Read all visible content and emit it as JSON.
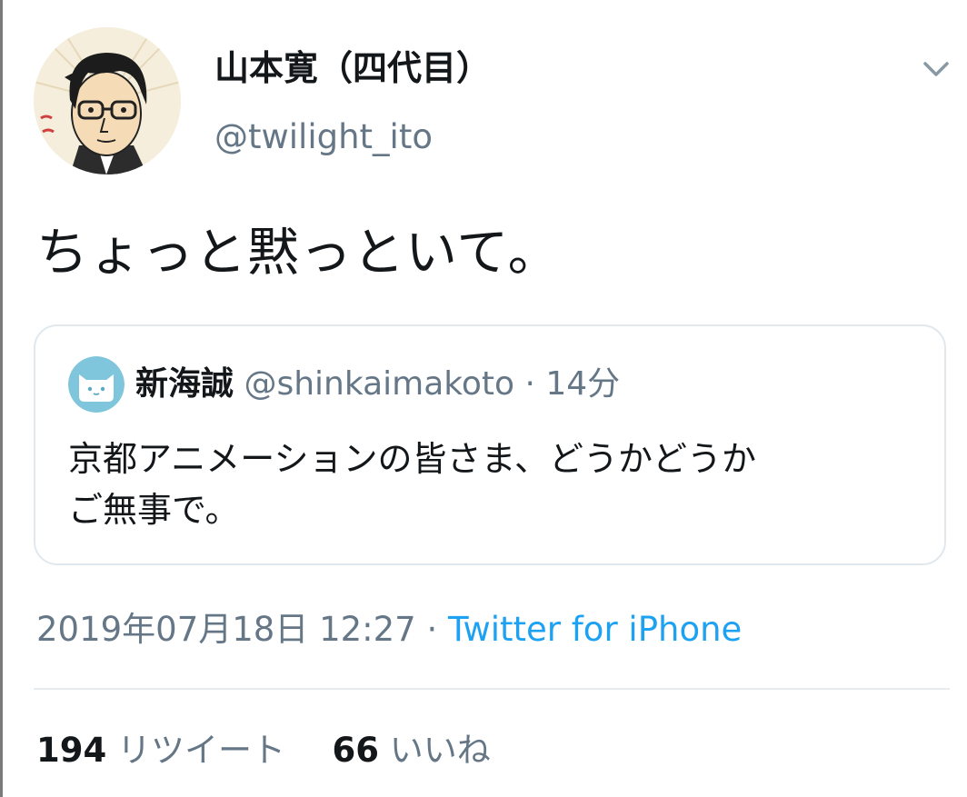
{
  "tweet": {
    "author": {
      "display_name": "山本寛（四代目）",
      "handle": "@twilight_ito"
    },
    "text": "ちょっと黙っといて。",
    "quoted": {
      "display_name": "新海誠",
      "handle": "@shinkaimakoto",
      "separator": "·",
      "time": "14分",
      "text_lines": [
        "京都アニメーションの皆さま、どうかどうか",
        "ご無事で。"
      ]
    },
    "timestamp": "2019年07月18日 12:27",
    "separator": "·",
    "source": "Twitter for iPhone",
    "stats": {
      "retweets_count": "194",
      "retweets_label": "リツイート",
      "likes_count": "66",
      "likes_label": "いいね"
    }
  },
  "icons": {
    "menu": "chevron-down-icon",
    "avatar": "avatar",
    "quote_avatar": "cat-avatar"
  },
  "colors": {
    "text_primary": "#14171a",
    "text_secondary": "#657786",
    "link": "#1da1f2",
    "border": "#e1e8ed"
  }
}
